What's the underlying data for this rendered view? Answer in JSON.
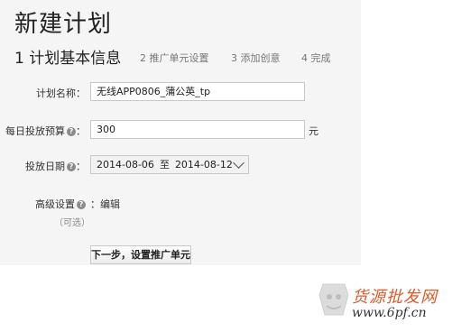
{
  "page": {
    "title": "新建计划"
  },
  "steps": {
    "current": "1 计划基本信息",
    "step2": "2 推广单元设置",
    "step3": "3 添加创意",
    "step4": "4 完成"
  },
  "form": {
    "name_label": "计划名称：",
    "name_value": "无线APP0806_蒲公英_tp",
    "budget_label": "每日投放预算",
    "budget_value": "300",
    "budget_unit": "元",
    "date_label": "投放日期",
    "date_start": "2014-08-06",
    "date_sep": "至",
    "date_end": "2014-08-12",
    "advanced_label": "高级设置",
    "advanced_edit": "：编辑",
    "optional": "（可选）",
    "next_button": "下一步，设置推广单元"
  },
  "watermark": {
    "text": "货源批发网",
    "url": "www.6pf.cn"
  },
  "colors": {
    "panel_bg": "#f5f5f5",
    "watermark_accent": "#e05a2a"
  }
}
